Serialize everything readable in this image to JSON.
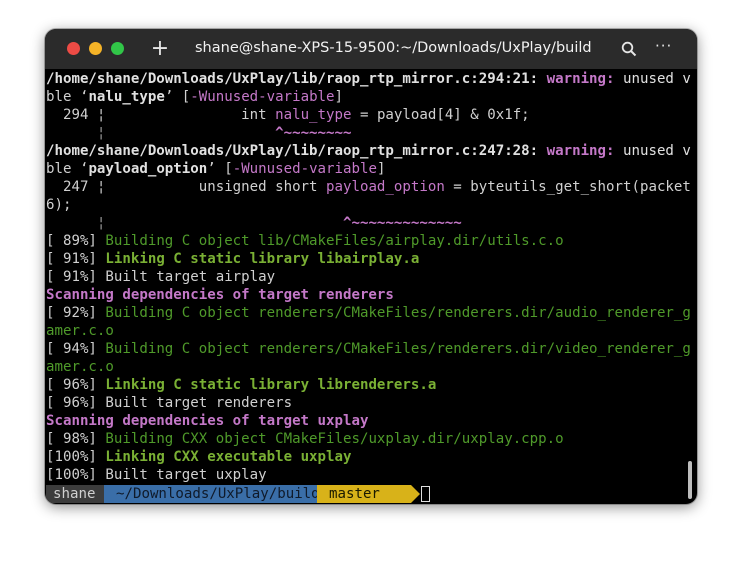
{
  "window": {
    "title": "shane@shane-XPS-15-9500:~/Downloads/UxPlay/build"
  },
  "toolbar": {
    "new_tab_glyph": "+",
    "menu_glyph": "···"
  },
  "terminal": {
    "l01": {
      "a": "/home/shane/Downloads/UxPlay/lib/raop_rtp_mirror.c:294:21:",
      "b": " warning:",
      "c": " unused varia"
    },
    "l02": {
      "a": "ble ‘",
      "b": "nalu_type",
      "c": "’ [",
      "d": "-Wunused-variable",
      "e": "]"
    },
    "l03": {
      "a": "  294 ¦                int ",
      "b": "nalu_type",
      "c": " = payload[4] & 0x1f;"
    },
    "l04": {
      "a": "      ¦                    ",
      "b": "^~~~~~~~~"
    },
    "l05": {
      "a": "/home/shane/Downloads/UxPlay/lib/raop_rtp_mirror.c:247:28:",
      "b": " warning:",
      "c": " unused varia"
    },
    "l06": {
      "a": "ble ‘",
      "b": "payload_option",
      "c": "’ [",
      "d": "-Wunused-variable",
      "e": "]"
    },
    "l07": {
      "a": "  247 ¦           unsigned short ",
      "b": "payload_option",
      "c": " = byteutils_get_short(packet,"
    },
    "l08": {
      "a": "6);"
    },
    "l09": {
      "a": "      ¦                            ",
      "b": "^~~~~~~~~~~~~~"
    },
    "l10": {
      "a": "[ 89%] ",
      "b": "Building C object lib/CMakeFiles/airplay.dir/utils.c.o"
    },
    "l11": {
      "a": "[ 91%] ",
      "b": "Linking C static library libairplay.a"
    },
    "l12": {
      "a": "[ 91%] Built target airplay"
    },
    "l13": {
      "a": "Scanning dependencies of target renderers"
    },
    "l14": {
      "a": "[ 92%] ",
      "b": "Building C object renderers/CMakeFiles/renderers.dir/audio_renderer_gstre"
    },
    "l15": {
      "a": "amer.c.o"
    },
    "l16": {
      "a": "[ 94%] ",
      "b": "Building C object renderers/CMakeFiles/renderers.dir/video_renderer_gstre"
    },
    "l17": {
      "a": "amer.c.o"
    },
    "l18": {
      "a": "[ 96%] ",
      "b": "Linking C static library librenderers.a"
    },
    "l19": {
      "a": "[ 96%] Built target renderers"
    },
    "l20": {
      "a": "Scanning dependencies of target uxplay"
    },
    "l21": {
      "a": "[ 98%] ",
      "b": "Building CXX object CMakeFiles/uxplay.dir/uxplay.cpp.o"
    },
    "l22": {
      "a": "[100%] ",
      "b": "Linking CXX executable uxplay"
    },
    "l23": {
      "a": "[100%] Built target uxplay"
    }
  },
  "prompt": {
    "user": "shane",
    "path": "~/Downloads/UxPlay/build",
    "branch_icon": "",
    "branch": "master"
  },
  "colors": {
    "warning": "#c478c8",
    "build": "#4f9a2a",
    "link": "#7ab034",
    "path_segment": "#3a6ea8",
    "branch_segment": "#d8b219"
  }
}
